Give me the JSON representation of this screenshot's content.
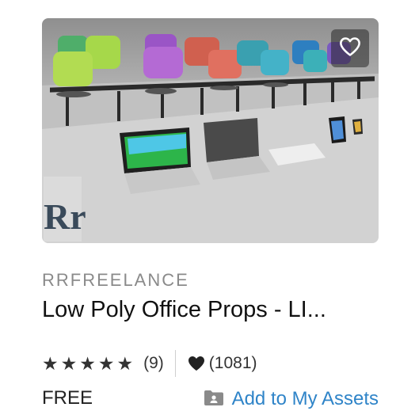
{
  "card": {
    "seller": "RRFREELANCE",
    "title": "Low Poly Office Props - LI...",
    "rating_stars": 5,
    "rating_count": "(9)",
    "favorites_count": "(1081)",
    "price": "FREE",
    "add_to_assets_label": "Add to My Assets",
    "thumbnail_logo_text": "Rr",
    "colors": {
      "link": "#2f84c8",
      "seller": "#8a8a8a",
      "title": "#111111"
    },
    "icons": {
      "wishlist": "heart-outline-icon",
      "star": "star-filled-icon",
      "favorites": "heart-filled-icon",
      "add_assets": "folder-user-icon"
    }
  }
}
